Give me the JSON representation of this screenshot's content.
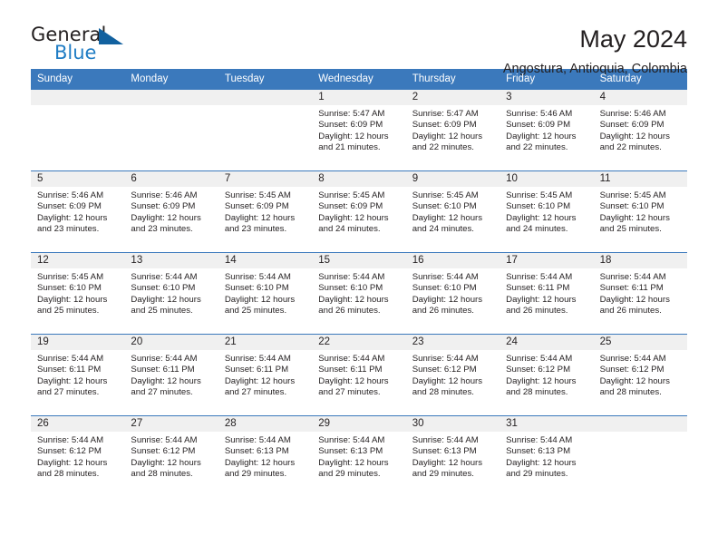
{
  "brand": {
    "name_part1": "General",
    "name_part2": "Blue",
    "triangle_color": "#12619f",
    "blue_text_color": "#1f7cc4"
  },
  "header": {
    "title": "May 2024",
    "subtitle": "Angostura, Antioquia, Colombia",
    "header_bg_color": "#3b79bc",
    "header_text_color": "#ffffff",
    "daynum_bg_color": "#f0f0f0"
  },
  "weekdays": [
    "Sunday",
    "Monday",
    "Tuesday",
    "Wednesday",
    "Thursday",
    "Friday",
    "Saturday"
  ],
  "weeks": [
    [
      {
        "day": "",
        "sunrise": "",
        "sunset": "",
        "daylight1": "",
        "daylight2": ""
      },
      {
        "day": "",
        "sunrise": "",
        "sunset": "",
        "daylight1": "",
        "daylight2": ""
      },
      {
        "day": "",
        "sunrise": "",
        "sunset": "",
        "daylight1": "",
        "daylight2": ""
      },
      {
        "day": "1",
        "sunrise": "Sunrise: 5:47 AM",
        "sunset": "Sunset: 6:09 PM",
        "daylight1": "Daylight: 12 hours",
        "daylight2": "and 21 minutes."
      },
      {
        "day": "2",
        "sunrise": "Sunrise: 5:47 AM",
        "sunset": "Sunset: 6:09 PM",
        "daylight1": "Daylight: 12 hours",
        "daylight2": "and 22 minutes."
      },
      {
        "day": "3",
        "sunrise": "Sunrise: 5:46 AM",
        "sunset": "Sunset: 6:09 PM",
        "daylight1": "Daylight: 12 hours",
        "daylight2": "and 22 minutes."
      },
      {
        "day": "4",
        "sunrise": "Sunrise: 5:46 AM",
        "sunset": "Sunset: 6:09 PM",
        "daylight1": "Daylight: 12 hours",
        "daylight2": "and 22 minutes."
      }
    ],
    [
      {
        "day": "5",
        "sunrise": "Sunrise: 5:46 AM",
        "sunset": "Sunset: 6:09 PM",
        "daylight1": "Daylight: 12 hours",
        "daylight2": "and 23 minutes."
      },
      {
        "day": "6",
        "sunrise": "Sunrise: 5:46 AM",
        "sunset": "Sunset: 6:09 PM",
        "daylight1": "Daylight: 12 hours",
        "daylight2": "and 23 minutes."
      },
      {
        "day": "7",
        "sunrise": "Sunrise: 5:45 AM",
        "sunset": "Sunset: 6:09 PM",
        "daylight1": "Daylight: 12 hours",
        "daylight2": "and 23 minutes."
      },
      {
        "day": "8",
        "sunrise": "Sunrise: 5:45 AM",
        "sunset": "Sunset: 6:09 PM",
        "daylight1": "Daylight: 12 hours",
        "daylight2": "and 24 minutes."
      },
      {
        "day": "9",
        "sunrise": "Sunrise: 5:45 AM",
        "sunset": "Sunset: 6:10 PM",
        "daylight1": "Daylight: 12 hours",
        "daylight2": "and 24 minutes."
      },
      {
        "day": "10",
        "sunrise": "Sunrise: 5:45 AM",
        "sunset": "Sunset: 6:10 PM",
        "daylight1": "Daylight: 12 hours",
        "daylight2": "and 24 minutes."
      },
      {
        "day": "11",
        "sunrise": "Sunrise: 5:45 AM",
        "sunset": "Sunset: 6:10 PM",
        "daylight1": "Daylight: 12 hours",
        "daylight2": "and 25 minutes."
      }
    ],
    [
      {
        "day": "12",
        "sunrise": "Sunrise: 5:45 AM",
        "sunset": "Sunset: 6:10 PM",
        "daylight1": "Daylight: 12 hours",
        "daylight2": "and 25 minutes."
      },
      {
        "day": "13",
        "sunrise": "Sunrise: 5:44 AM",
        "sunset": "Sunset: 6:10 PM",
        "daylight1": "Daylight: 12 hours",
        "daylight2": "and 25 minutes."
      },
      {
        "day": "14",
        "sunrise": "Sunrise: 5:44 AM",
        "sunset": "Sunset: 6:10 PM",
        "daylight1": "Daylight: 12 hours",
        "daylight2": "and 25 minutes."
      },
      {
        "day": "15",
        "sunrise": "Sunrise: 5:44 AM",
        "sunset": "Sunset: 6:10 PM",
        "daylight1": "Daylight: 12 hours",
        "daylight2": "and 26 minutes."
      },
      {
        "day": "16",
        "sunrise": "Sunrise: 5:44 AM",
        "sunset": "Sunset: 6:10 PM",
        "daylight1": "Daylight: 12 hours",
        "daylight2": "and 26 minutes."
      },
      {
        "day": "17",
        "sunrise": "Sunrise: 5:44 AM",
        "sunset": "Sunset: 6:11 PM",
        "daylight1": "Daylight: 12 hours",
        "daylight2": "and 26 minutes."
      },
      {
        "day": "18",
        "sunrise": "Sunrise: 5:44 AM",
        "sunset": "Sunset: 6:11 PM",
        "daylight1": "Daylight: 12 hours",
        "daylight2": "and 26 minutes."
      }
    ],
    [
      {
        "day": "19",
        "sunrise": "Sunrise: 5:44 AM",
        "sunset": "Sunset: 6:11 PM",
        "daylight1": "Daylight: 12 hours",
        "daylight2": "and 27 minutes."
      },
      {
        "day": "20",
        "sunrise": "Sunrise: 5:44 AM",
        "sunset": "Sunset: 6:11 PM",
        "daylight1": "Daylight: 12 hours",
        "daylight2": "and 27 minutes."
      },
      {
        "day": "21",
        "sunrise": "Sunrise: 5:44 AM",
        "sunset": "Sunset: 6:11 PM",
        "daylight1": "Daylight: 12 hours",
        "daylight2": "and 27 minutes."
      },
      {
        "day": "22",
        "sunrise": "Sunrise: 5:44 AM",
        "sunset": "Sunset: 6:11 PM",
        "daylight1": "Daylight: 12 hours",
        "daylight2": "and 27 minutes."
      },
      {
        "day": "23",
        "sunrise": "Sunrise: 5:44 AM",
        "sunset": "Sunset: 6:12 PM",
        "daylight1": "Daylight: 12 hours",
        "daylight2": "and 28 minutes."
      },
      {
        "day": "24",
        "sunrise": "Sunrise: 5:44 AM",
        "sunset": "Sunset: 6:12 PM",
        "daylight1": "Daylight: 12 hours",
        "daylight2": "and 28 minutes."
      },
      {
        "day": "25",
        "sunrise": "Sunrise: 5:44 AM",
        "sunset": "Sunset: 6:12 PM",
        "daylight1": "Daylight: 12 hours",
        "daylight2": "and 28 minutes."
      }
    ],
    [
      {
        "day": "26",
        "sunrise": "Sunrise: 5:44 AM",
        "sunset": "Sunset: 6:12 PM",
        "daylight1": "Daylight: 12 hours",
        "daylight2": "and 28 minutes."
      },
      {
        "day": "27",
        "sunrise": "Sunrise: 5:44 AM",
        "sunset": "Sunset: 6:12 PM",
        "daylight1": "Daylight: 12 hours",
        "daylight2": "and 28 minutes."
      },
      {
        "day": "28",
        "sunrise": "Sunrise: 5:44 AM",
        "sunset": "Sunset: 6:13 PM",
        "daylight1": "Daylight: 12 hours",
        "daylight2": "and 29 minutes."
      },
      {
        "day": "29",
        "sunrise": "Sunrise: 5:44 AM",
        "sunset": "Sunset: 6:13 PM",
        "daylight1": "Daylight: 12 hours",
        "daylight2": "and 29 minutes."
      },
      {
        "day": "30",
        "sunrise": "Sunrise: 5:44 AM",
        "sunset": "Sunset: 6:13 PM",
        "daylight1": "Daylight: 12 hours",
        "daylight2": "and 29 minutes."
      },
      {
        "day": "31",
        "sunrise": "Sunrise: 5:44 AM",
        "sunset": "Sunset: 6:13 PM",
        "daylight1": "Daylight: 12 hours",
        "daylight2": "and 29 minutes."
      },
      {
        "day": "",
        "sunrise": "",
        "sunset": "",
        "daylight1": "",
        "daylight2": ""
      }
    ]
  ]
}
